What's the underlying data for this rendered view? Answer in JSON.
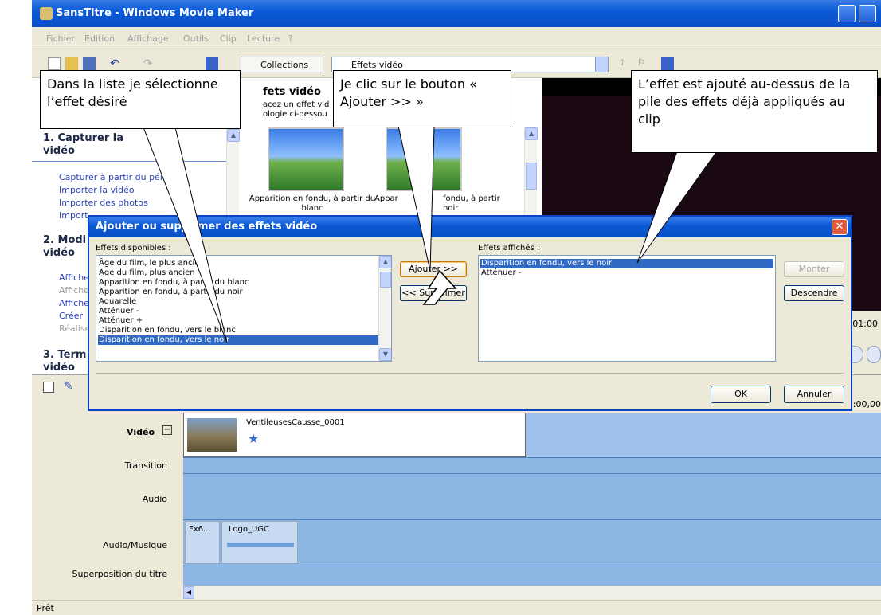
{
  "window": {
    "title": "SansTitre - Windows Movie Maker"
  },
  "menu": [
    "Fichier",
    "Edition",
    "Affichage",
    "Outils",
    "Clip",
    "Lecture",
    "?"
  ],
  "toolbar": {
    "collections_label": "Collections",
    "combo_value": "Effets vidéo"
  },
  "taskpane": {
    "section1": "1. Capturer la vidéo",
    "section1_links": [
      "Capturer à partir du périphe",
      "Importer la vidéo",
      "Importer des photos",
      "Import"
    ],
    "section2": "2. Modi vidéo",
    "section2_links": [
      "Affiche",
      "Affiche",
      "Affiche",
      "Créer",
      "Réalise"
    ],
    "section3": "3. Term vidéo"
  },
  "effects_panel": {
    "title": "fets vidéo",
    "desc1": "acez un effet vid",
    "desc2": "ologie ci-dessou",
    "items": [
      "Apparition en fondu, à partir du blanc",
      "Appar",
      "fondu, à partir",
      "noir"
    ]
  },
  "preview": {
    "time1": ":01:00",
    "time2": "2:00,00"
  },
  "timeline": {
    "tracks": [
      "Vidéo",
      "Transition",
      "Audio",
      "Audio/Musique",
      "Superposition du titre"
    ],
    "video_clip": "VentileusesCausse_0001",
    "audio_clips": [
      "Fx6...",
      "Logo_UGC"
    ]
  },
  "status": "Prêt",
  "dialog": {
    "title": "Ajouter ou supprimer des effets vidéo",
    "available_label": "Effets disponibles :",
    "shown_label": "Effets affichés :",
    "available": [
      "Âge du film, le plus ancien",
      "Âge du film, plus ancien",
      "Apparition en fondu, à partir du blanc",
      "Apparition en fondu, à partir du noir",
      "Aquarelle",
      "Atténuer -",
      "Atténuer +",
      "Disparition en fondu, vers le blanc",
      "Disparition en fondu, vers le noir"
    ],
    "shown": [
      "Disparition en fondu, vers le noir",
      "Atténuer -"
    ],
    "add_btn": "Ajouter >>",
    "remove_btn": "<< Supprimer",
    "up_btn": "Monter",
    "down_btn": "Descendre",
    "ok_btn": "OK",
    "cancel_btn": "Annuler"
  },
  "callouts": {
    "left": "Dans la liste je sélectionne l’effet désiré",
    "middle": "Je clic sur le bouton « Ajouter >> »",
    "right": "L’effet est ajouté au-dessus de la pile des effets déjà appliqués au clip"
  }
}
